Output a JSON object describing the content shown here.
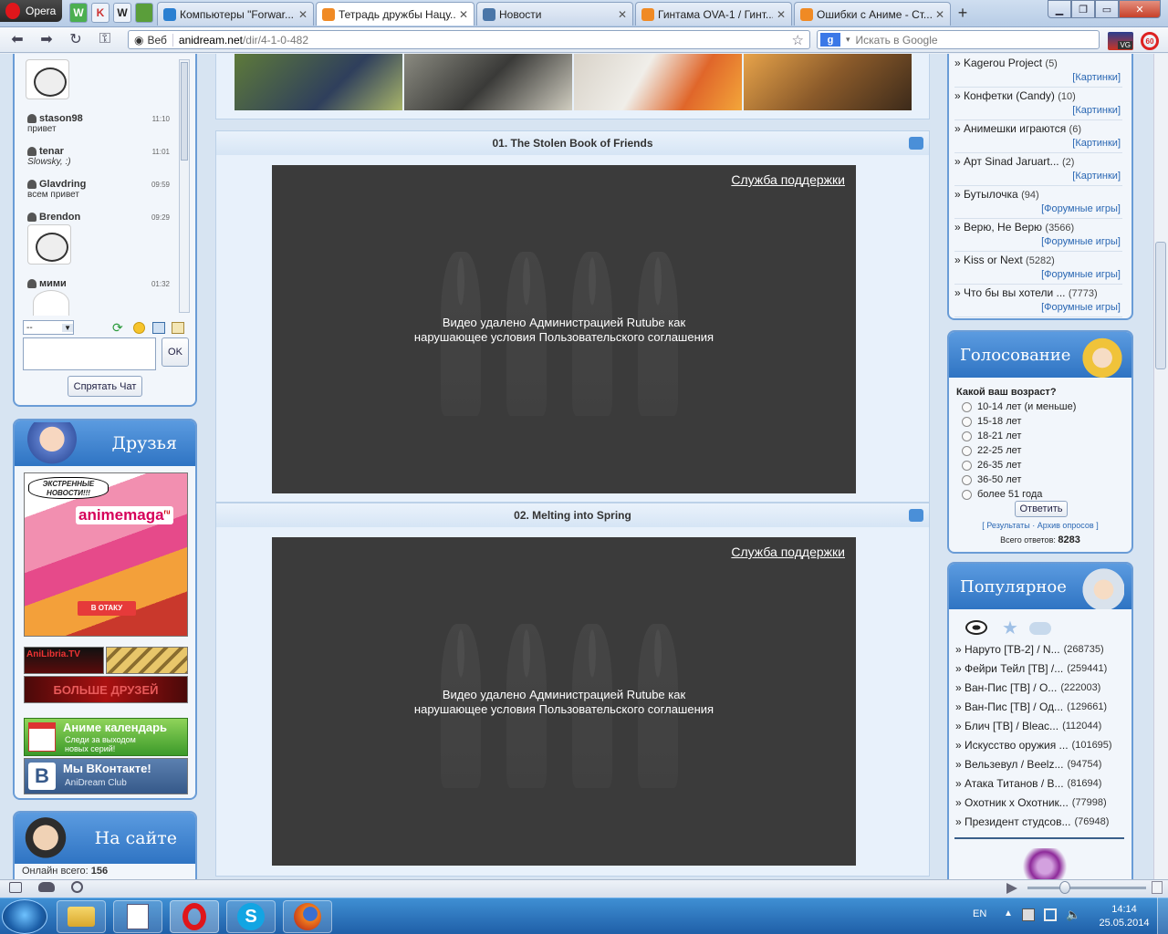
{
  "browser": {
    "opera_label": "Opera",
    "pinned": [
      "W",
      "K",
      "W"
    ],
    "tabs": [
      {
        "label": "Компьютеры \"Forwar...",
        "icon_color": "#2a7fd1"
      },
      {
        "label": "Тетрадь дружбы Нацу...",
        "icon_color": "#f08a24",
        "active": true
      },
      {
        "label": "Новости",
        "icon_color": "#4a76a8"
      },
      {
        "label": "Гинтама OVA-1 / Гинт...",
        "icon_color": "#f08a24"
      },
      {
        "label": "Ошибки с Аниме - Ст...",
        "icon_color": "#f08a24"
      }
    ],
    "web_label": "Веб",
    "url_domain": "anidream.net",
    "url_path": "/dir/4-1-0-482",
    "search_placeholder": "Искать в Google",
    "search_engine": "g",
    "lang_badge": "VG"
  },
  "chat": {
    "messages": [
      {
        "user": "stason98",
        "time": "11:10",
        "text": "привет"
      },
      {
        "user": "tenar",
        "time": "11:01",
        "text": "Slowsky, :)"
      },
      {
        "user": "Glavdring",
        "time": "09:59",
        "text": "всем привет"
      },
      {
        "user": "Brendon",
        "time": "09:29",
        "text": ""
      },
      {
        "user": "мими",
        "time": "01:32",
        "text": ""
      }
    ],
    "select_value": "--",
    "ok_label": "OK",
    "hide_label": "Спрятать Чат"
  },
  "friends": {
    "title": "Друзья",
    "banner_news": "ЭКСТРЕННЫЕ НОВОСТИ!!!",
    "banner_brand": "animemaga",
    "banner_brand_suffix": "ru",
    "banner_btn": "В ОТАКУ",
    "anilibria": "AniLibria.TV",
    "more_friends": "БОЛЬШЕ ДРУЗЕЙ",
    "calendar_title": "Аниме календарь",
    "calendar_sub": "Следи за выходом новых серий!",
    "vk_title": "Мы ВКонтакте!",
    "vk_sub": "AniDream Club"
  },
  "online": {
    "title": "На сайте",
    "total_label": "Онлайн всего:",
    "total": "156"
  },
  "videos": [
    {
      "title": "01. The Stolen Book of Friends",
      "support": "Служба поддержки",
      "message_1": "Видео удалено Администрацией Rutube как",
      "message_2": "нарушающее условия Пользовательского соглашения"
    },
    {
      "title": "02. Melting into Spring",
      "support": "Служба поддержки",
      "message_1": "Видео удалено Администрацией Rutube как",
      "message_2": "нарушающее условия Пользовательского соглашения"
    }
  ],
  "forum_list": [
    {
      "name": "» Kagerou Project",
      "count": "(5)",
      "cat": "[Картинки]"
    },
    {
      "name": "» Конфетки (Candy)",
      "count": "(10)",
      "cat": "[Картинки]"
    },
    {
      "name": "» Анимешки играются",
      "count": "(6)",
      "cat": "[Картинки]"
    },
    {
      "name": "» Арт Sinad Jaruart...",
      "count": "(2)",
      "cat": "[Картинки]"
    },
    {
      "name": "» Бутылочка",
      "count": "(94)",
      "cat": "[Форумные игры]"
    },
    {
      "name": "» Верю, Не Верю",
      "count": "(3566)",
      "cat": "[Форумные игры]"
    },
    {
      "name": "» Kiss or Next",
      "count": "(5282)",
      "cat": "[Форумные игры]"
    },
    {
      "name": "» Что бы вы хотели ...",
      "count": "(7773)",
      "cat": "[Форумные игры]"
    }
  ],
  "poll": {
    "title": "Голосование",
    "question": "Какой ваш возраст?",
    "options": [
      "10-14 лет (и меньше)",
      "15-18 лет",
      "18-21 лет",
      "22-25 лет",
      "26-35 лет",
      "36-50 лет",
      "более 51 года"
    ],
    "submit": "Ответить",
    "results": "Результаты",
    "archive": "Архив опросов",
    "total_label": "Всего ответов:",
    "total": "8283"
  },
  "popular": {
    "title": "Популярное",
    "items": [
      {
        "name": "» Наруто [ТВ-2] / N...",
        "count": "(268735)"
      },
      {
        "name": "» Фейри Тейл [ТВ] /...",
        "count": "(259441)"
      },
      {
        "name": "» Ван-Пис [ТВ] / О...",
        "count": "(222003)"
      },
      {
        "name": "» Ван-Пис [ТВ] / Од...",
        "count": "(129661)"
      },
      {
        "name": "» Блич [ТВ] / Bleac...",
        "count": "(112044)"
      },
      {
        "name": "» Искусство оружия ...",
        "count": "(101695)"
      },
      {
        "name": "» Вельзевул / Beelz...",
        "count": "(94754)"
      },
      {
        "name": "» Атака Титанов / В...",
        "count": "(81694)"
      },
      {
        "name": "» Охотник х Охотник...",
        "count": "(77998)"
      },
      {
        "name": "» Президент студсов...",
        "count": "(76948)"
      }
    ]
  },
  "taskbar": {
    "lang": "EN",
    "time": "14:14",
    "date": "25.05.2014"
  },
  "colors": {
    "accent": "#2f74c3",
    "link": "#2a67b3",
    "player_bg": "#3b3b3b"
  }
}
